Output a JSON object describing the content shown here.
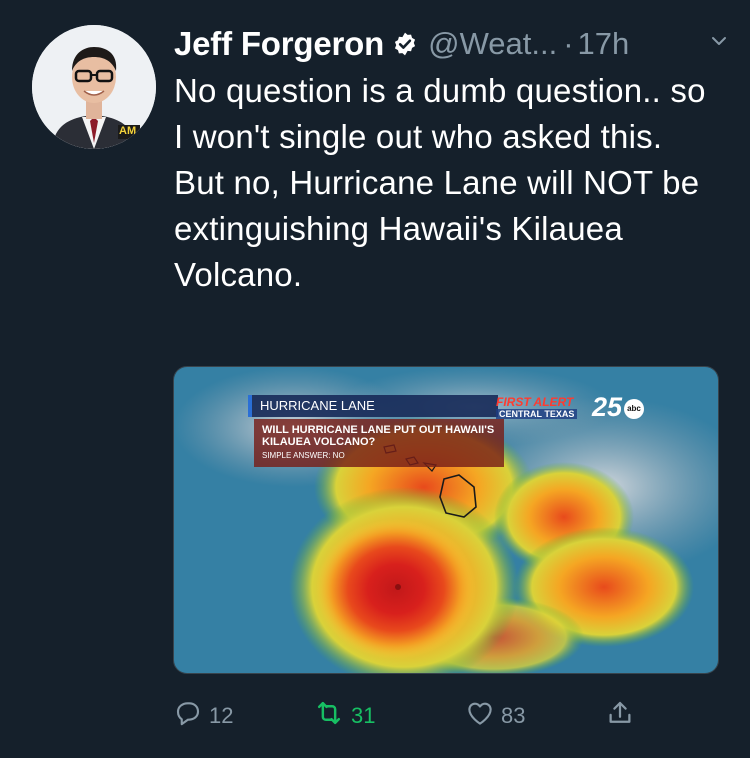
{
  "tweet": {
    "author": {
      "name": "Jeff Forgeron",
      "handle": "@Weat...",
      "verified_icon": "verified-badge-icon",
      "avatar_badge": "AM"
    },
    "time_separator": "·",
    "time": "17h",
    "text": "No question is a dumb question.. so I won't single out who asked this. But no, Hurricane Lane will NOT be extinguishing Hawaii's Kilauea Volcano.",
    "media": {
      "overlay_title": "HURRICANE LANE",
      "question": "WILL HURRICANE LANE PUT OUT HAWAII'S KILAUEA VOLCANO?",
      "answer": "SIMPLE ANSWER: NO",
      "brand_alert": "FIRST ALERT",
      "brand_sub": "CENTRAL TEXAS",
      "brand_number": "25",
      "brand_network": "abc"
    },
    "actions": {
      "reply_count": "12",
      "retweet_count": "31",
      "like_count": "83"
    },
    "colors": {
      "background": "#15202b",
      "secondary_text": "#8899a6",
      "retweet_active": "#17bf63",
      "verified": "#ffffff"
    }
  }
}
